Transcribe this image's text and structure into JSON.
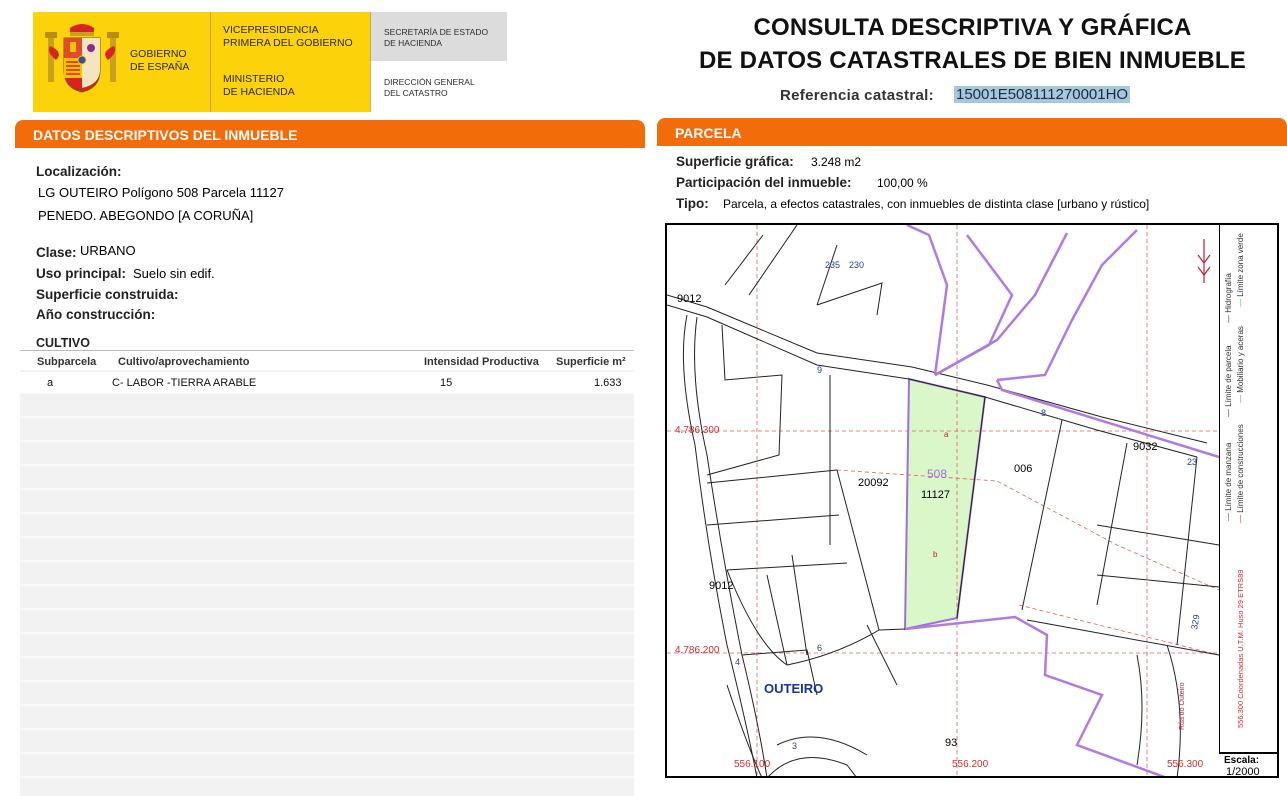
{
  "header": {
    "gobierno_line1": "GOBIERNO",
    "gobierno_line2": "DE ESPAÑA",
    "vicepres_line1": "VICEPRESIDENCIA",
    "vicepres_line2": "PRIMERA DEL GOBIERNO",
    "ministerio_line1": "MINISTERIO",
    "ministerio_line2": "DE HACIENDA",
    "secretaria_line1": "SECRETARÍA DE ESTADO",
    "secretaria_line2": "DE HACIENDA",
    "direccion_line1": "DIRECCIÓN GENERAL",
    "direccion_line2": "DEL CATASTRO",
    "title_line1": "CONSULTA DESCRIPTIVA Y GRÁFICA",
    "title_line2": "DE DATOS CATASTRALES DE BIEN INMUEBLE",
    "refcat_label": "Referencia catastral:",
    "refcat_value": "15001E508111270001HO"
  },
  "colors": {
    "accent": "#f26d0a",
    "logo_yellow": "#fcd20a",
    "parcel_fill": "#d9f7c9",
    "boundary_purple": "#b07be0"
  },
  "descriptivos": {
    "bar_title": "DATOS DESCRIPTIVOS DEL INMUEBLE",
    "localizacion_label": "Localización:",
    "localizacion_line1": "LG OUTEIRO  Polígono 508 Parcela 11127",
    "localizacion_line2": "PENEDO. ABEGONDO [A CORUÑA]",
    "clase_label": "Clase:",
    "clase_value": "URBANO",
    "uso_label": "Uso principal:",
    "uso_value": "Suelo sin edif.",
    "superficie_construida_label": "Superficie construida:",
    "anio_label": "Año construcción:"
  },
  "cultivo": {
    "title": "CULTIVO",
    "headers": [
      "Subparcela",
      "Cultivo/aprovechamiento",
      "Intensidad Productiva",
      "Superficie m²"
    ],
    "rows": [
      {
        "subparcela": "a",
        "cultivo": "C- LABOR -TIERRA ARABLE",
        "intensidad": "15",
        "superficie": "1.633"
      }
    ]
  },
  "parcela": {
    "bar_title": "PARCELA",
    "superficie_label": "Superficie gráfica:",
    "superficie_value": "3.248 m2",
    "participacion_label": "Participación del inmueble:",
    "participacion_value": "100,00 %",
    "tipo_label": "Tipo:",
    "tipo_value": "Parcela, a efectos catastrales, con inmuebles de distinta clase [urbano y rústico]"
  },
  "map": {
    "labels": {
      "l9012a": "9012",
      "l9012b": "9012",
      "l9032": "9032",
      "l20092": "20092",
      "l006": "006",
      "l508": "508",
      "l11127": "11127",
      "la": "a",
      "lb": "b",
      "l93": "93",
      "l235": "235",
      "l230": "230",
      "outeiro": "OUTEIRO",
      "coord_y1": "4.786.300",
      "coord_y2": "4.786.200",
      "coord_x1": "556.100",
      "coord_x2": "556.200",
      "coord_x3": "556.300",
      "n9": "9",
      "n8": "8",
      "n23": "23",
      "n6": "6",
      "n4": "4",
      "n3": "3",
      "n329": "329",
      "road_name": "Rúa do Outeiro"
    },
    "legend": {
      "hidrografia": "Hidrografía",
      "limite_zona_verde": "Límite zona verde",
      "limite_parcela": "Límite de parcela",
      "mobiliario": "Mobiliario y aceras",
      "limite_manzana": "Límite de manzana",
      "limite_construcciones": "Límite de construcciones",
      "coordenadas": "556.300 Coordenadas U.T.M. Huso 29 ETRS89",
      "escala_label": "Escala:",
      "escala_value": "1/2000"
    }
  }
}
